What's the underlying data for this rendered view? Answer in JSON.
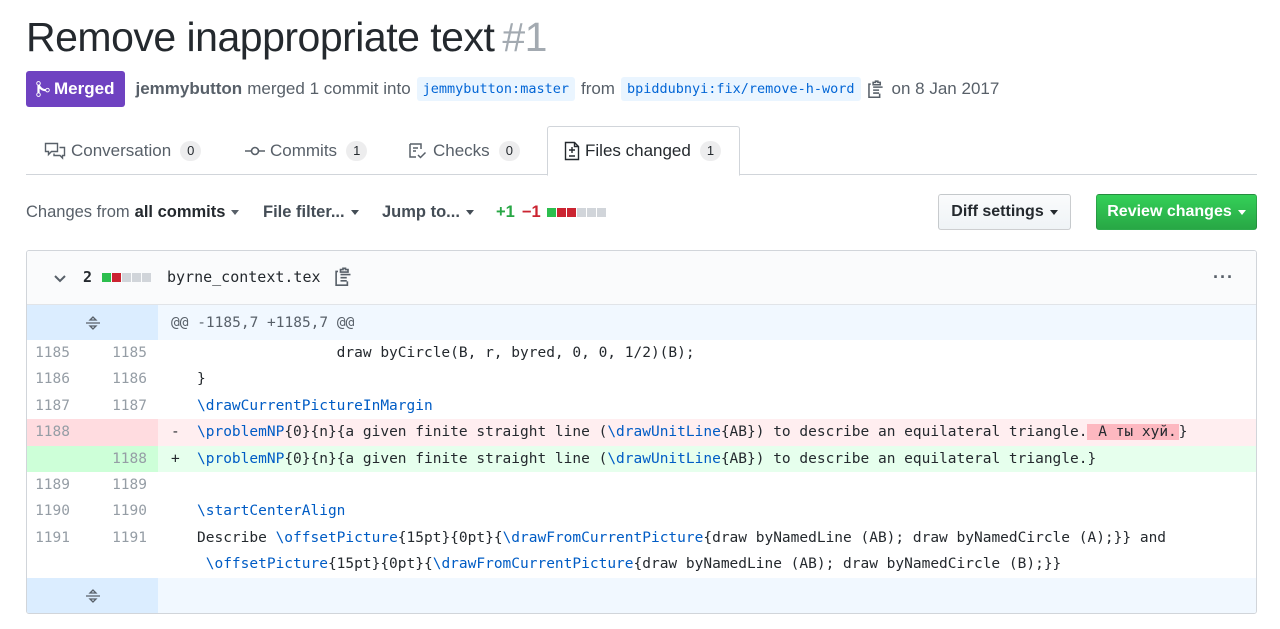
{
  "pr": {
    "title": "Remove inappropriate text",
    "number": "#1",
    "status": "Merged",
    "author": "jemmybutton",
    "action_text": "merged 1 commit into",
    "base_branch": "jemmybutton:master",
    "from_text": "from",
    "head_branch": "bpiddubnyi:fix/remove-h-word",
    "date_text": "on 8 Jan 2017"
  },
  "tabs": [
    {
      "label": "Conversation",
      "count": "0",
      "icon": "comment-icon"
    },
    {
      "label": "Commits",
      "count": "1",
      "icon": "commit-icon"
    },
    {
      "label": "Checks",
      "count": "0",
      "icon": "checklist-icon"
    },
    {
      "label": "Files changed",
      "count": "1",
      "icon": "file-diff-icon",
      "active": true
    }
  ],
  "toolbar": {
    "changes_from": "Changes from",
    "all_commits": "all commits",
    "file_filter": "File filter...",
    "jump_to": "Jump to...",
    "additions": "+1",
    "deletions": "−1",
    "diff_settings": "Diff settings",
    "review_changes": "Review changes"
  },
  "file": {
    "changes": "2",
    "name": "byrne_context.tex",
    "hunk_header": "@@ -1185,7 +1185,7 @@"
  },
  "diff_lines": {
    "l1": {
      "old": "1185",
      "new": "1185",
      "text": "                draw byCircle(B, r, byred, 0, 0, 1/2)(B);"
    },
    "l2": {
      "old": "1186",
      "new": "1186",
      "text": "}"
    },
    "l3": {
      "old": "1187",
      "new": "1187",
      "cmd": "\\drawCurrentPictureInMargin"
    },
    "l4": {
      "old": "1188",
      "marker": "-",
      "cmd": "\\problemNP",
      "a": "{0}{n}{a given finite straight line (",
      "cmd2": "\\drawUnitLine",
      "b": "{AB}) to describe an equilateral triangle.",
      "removed": " А ты хуй.",
      "end": "}"
    },
    "l5": {
      "new": "1188",
      "marker": "+",
      "cmd": "\\problemNP",
      "a": "{0}{n}{a given finite straight line (",
      "cmd2": "\\drawUnitLine",
      "b": "{AB}) to describe an equilateral triangle.}"
    },
    "l6": {
      "old": "1189",
      "new": "1189",
      "text": ""
    },
    "l7": {
      "old": "1190",
      "new": "1190",
      "cmd": "\\startCenterAlign"
    },
    "l8": {
      "old": "1191",
      "new": "1191",
      "pre": "Describe ",
      "cmd": "\\offsetPicture",
      "a": "{15pt}{0pt}{",
      "cmd2": "\\drawFromCurrentPicture",
      "b": "{draw byNamedLine (AB); draw byNamedCircle (A);}} and"
    },
    "l9": {
      "cmd": "\\offsetPicture",
      "a": "{15pt}{0pt}{",
      "cmd2": "\\drawFromCurrentPicture",
      "b": "{draw byNamedLine (AB); draw byNamedCircle (B);}}"
    }
  },
  "colors": {
    "merged_badge": "#6f42c1",
    "link_blue": "#0366d6",
    "addition_green": "#28a745",
    "deletion_red": "#cb2431"
  }
}
